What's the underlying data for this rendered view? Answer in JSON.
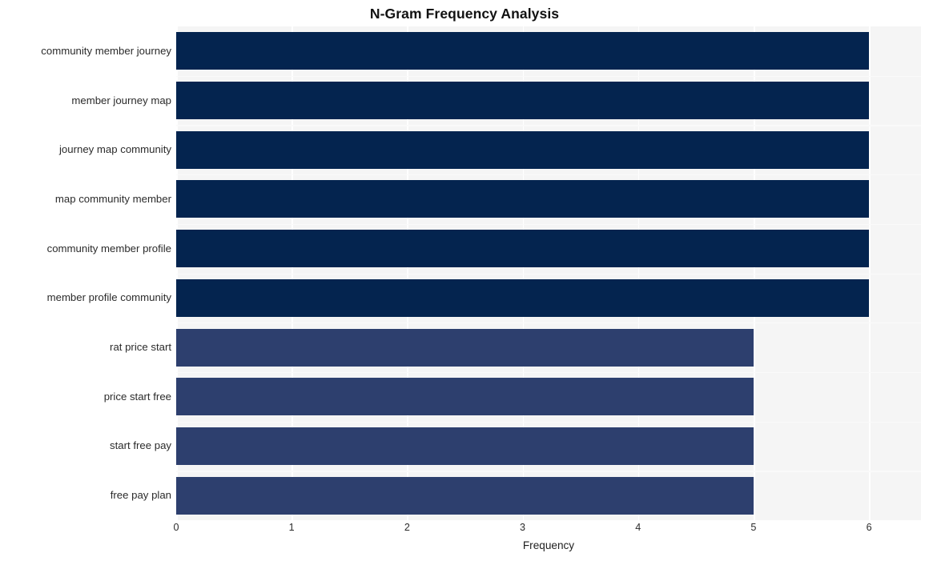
{
  "chart_data": {
    "type": "bar",
    "orientation": "horizontal",
    "title": "N-Gram Frequency Analysis",
    "xlabel": "Frequency",
    "ylabel": "",
    "xlim": [
      0,
      6.45
    ],
    "ylim": [
      0,
      10
    ],
    "grid": true,
    "legend": false,
    "xticks": [
      "0",
      "1",
      "2",
      "3",
      "4",
      "5",
      "6"
    ],
    "xtick_values": [
      0,
      1,
      2,
      3,
      4,
      5,
      6
    ],
    "categories": [
      "community member journey",
      "member journey map",
      "journey map community",
      "map community member",
      "community member profile",
      "member profile community",
      "rat price start",
      "price start free",
      "start free pay",
      "free pay plan"
    ],
    "values": [
      6,
      6,
      6,
      6,
      6,
      6,
      5,
      5,
      5,
      5
    ],
    "bar_colors": [
      "#04244f",
      "#04244f",
      "#04244f",
      "#04244f",
      "#04244f",
      "#04244f",
      "#2d3f6e",
      "#2d3f6e",
      "#2d3f6e",
      "#2d3f6e"
    ]
  },
  "style": {
    "plot_background": "#f5f5f5",
    "figure_background": "#ffffff",
    "gridline_color": "#ffffff",
    "title_color": "#111111",
    "tick_color": "#2b2b2b"
  }
}
